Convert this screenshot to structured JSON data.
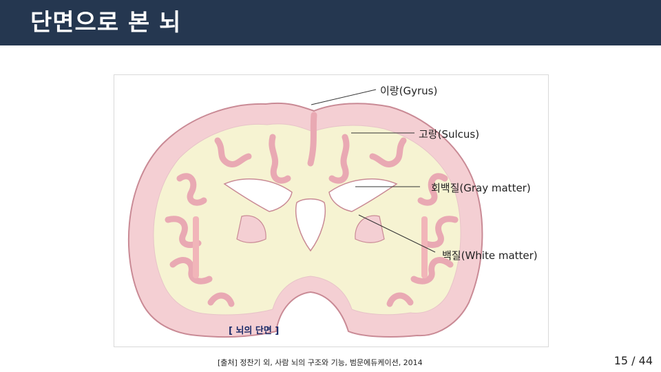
{
  "slide": {
    "title": "단면으로 본 뇌",
    "figure": {
      "caption": "[ 뇌의 단면 ]",
      "labels": {
        "gyrus": "이랑(Gyrus)",
        "sulcus": "고랑(Sulcus)",
        "gray_matter": "회백질(Gray matter)",
        "white_matter": "백질(White matter)"
      }
    },
    "source": "[출처] 정찬기 외, 사람 뇌의 구조와 기능, 범문에듀케이션, 2014",
    "page_number": "15 / 44"
  },
  "colors": {
    "header_bg": "#253750",
    "cortex": "#f4cfd3",
    "cortex_stroke": "#c98a95",
    "white_matter": "#f6f3d2",
    "caption": "#1b2a68"
  }
}
